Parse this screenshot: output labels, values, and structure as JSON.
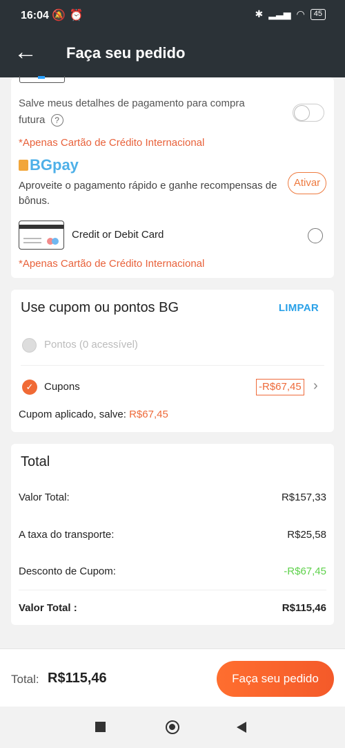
{
  "status_bar": {
    "time": "16:04",
    "battery": "45"
  },
  "header": {
    "title": "Faça seu pedido"
  },
  "payment": {
    "save_details_text": "Salve meus detalhes de pagamento para compra futura",
    "international_note_1": "*Apenas Cartão de Crédito  Internacional",
    "bgpay_logo": "BGpay",
    "bgpay_description": "Aproveite o pagamento rápido e ganhe recompensas de bônus.",
    "ativar_label": "Ativar",
    "card_option_label": "Credit or Debit Card",
    "international_note_2": "*Apenas Cartão de Crédito  Internacional"
  },
  "coupon": {
    "title": "Use cupom ou pontos BG",
    "clear_label": "LIMPAR",
    "points_label": "Pontos (0 acessível)",
    "coupons_label": "Cupons",
    "coupon_amount": "-R$67,45",
    "applied_prefix": "Cupom aplicado, salve:",
    "applied_amount": "R$67,45"
  },
  "total": {
    "title": "Total",
    "rows": [
      {
        "label": "Valor Total:",
        "value": "R$157,33"
      },
      {
        "label": "A taxa do transporte:",
        "value": "R$25,58"
      },
      {
        "label": "Desconto de Cupom:",
        "value": "-R$67,45"
      },
      {
        "label": "Valor Total :",
        "value": "R$115,46"
      }
    ]
  },
  "bottom_bar": {
    "total_label": "Total:",
    "total_value": "R$115,46",
    "order_button_label": "Faça seu pedido"
  },
  "colors": {
    "accent": "#f06a35",
    "header_bg": "#2b3237",
    "discount": "#5ed14b",
    "link": "#2aa1e8"
  }
}
